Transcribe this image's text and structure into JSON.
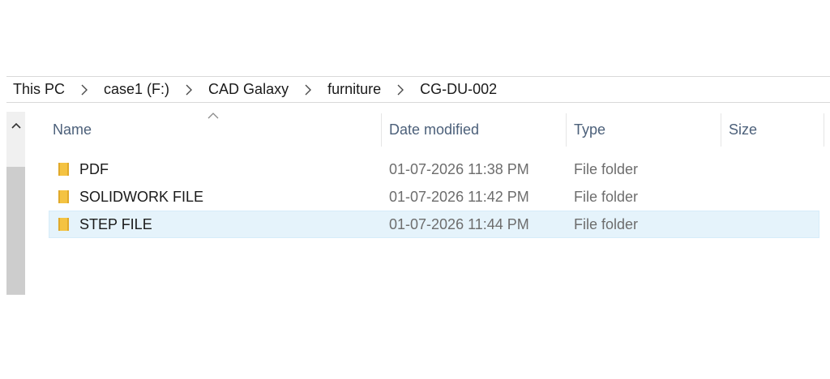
{
  "breadcrumb": [
    "This PC",
    "case1 (F:)",
    "CAD Galaxy",
    "furniture",
    "CG-DU-002"
  ],
  "columns": {
    "name": "Name",
    "date": "Date modified",
    "type": "Type",
    "size": "Size"
  },
  "sort": {
    "column": "Name",
    "direction": "ascending"
  },
  "files": [
    {
      "name": "PDF",
      "date": "01-07-2026 11:38 PM",
      "type": "File folder",
      "size": ""
    },
    {
      "name": "SOLIDWORK FILE",
      "date": "01-07-2026 11:42 PM",
      "type": "File folder",
      "size": ""
    },
    {
      "name": "STEP FILE",
      "date": "01-07-2026 11:44 PM",
      "type": "File folder",
      "size": "",
      "selected": true
    }
  ],
  "icons": {
    "separator": "chevron-right-icon",
    "folder": "folder-icon",
    "scroll_up": "chevron-up-icon",
    "sort": "sort-ascending-icon"
  },
  "colors": {
    "header_text": "#4c607a",
    "meta_text": "#6d6d6d",
    "selection_bg": "#e5f3fb",
    "folder_yellow": "#f4c342"
  }
}
